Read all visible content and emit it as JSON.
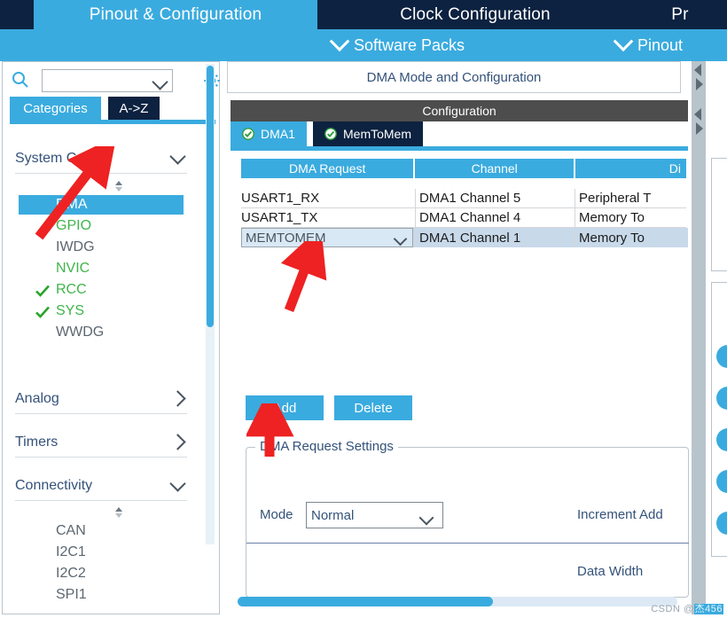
{
  "top_tabs": [
    {
      "label": "Pinout & Configuration",
      "active": true
    },
    {
      "label": "Clock Configuration",
      "active": false
    },
    {
      "label": "Pr",
      "active": false
    }
  ],
  "sub_bar": {
    "software_packs": "Software Packs",
    "pinout": "Pinout",
    "chevron_icon": "chevron-down-icon"
  },
  "sidebar": {
    "search": {
      "value": "",
      "placeholder": "",
      "icon": "search-icon"
    },
    "gear_icon": "gear-icon",
    "tabs": [
      {
        "label": "Categories",
        "active": true
      },
      {
        "label": "A->Z",
        "active": false
      }
    ],
    "groups": [
      {
        "label": "System Core",
        "expanded": true,
        "items": [
          {
            "label": "DMA",
            "state": "selected",
            "check": false
          },
          {
            "label": "GPIO",
            "state": "configured",
            "check": false
          },
          {
            "label": "IWDG",
            "state": "default",
            "check": false
          },
          {
            "label": "NVIC",
            "state": "configured",
            "check": false
          },
          {
            "label": "RCC",
            "state": "configured",
            "check": true
          },
          {
            "label": "SYS",
            "state": "configured",
            "check": true
          },
          {
            "label": "WWDG",
            "state": "default",
            "check": false
          }
        ]
      },
      {
        "label": "Analog",
        "expanded": false,
        "items": []
      },
      {
        "label": "Timers",
        "expanded": false,
        "items": []
      },
      {
        "label": "Connectivity",
        "expanded": true,
        "items": [
          {
            "label": "CAN",
            "state": "default",
            "check": false
          },
          {
            "label": "I2C1",
            "state": "default",
            "check": false
          },
          {
            "label": "I2C2",
            "state": "default",
            "check": false
          },
          {
            "label": "SPI1",
            "state": "default",
            "check": false
          }
        ]
      }
    ]
  },
  "main": {
    "mode_title": "DMA Mode and Configuration",
    "config_title": "Configuration",
    "config_tabs": [
      {
        "label": "DMA1",
        "active": true,
        "icon": "check-circle-icon"
      },
      {
        "label": "MemToMem",
        "active": false,
        "icon": "check-circle-icon"
      }
    ],
    "table": {
      "headers": [
        "DMA Request",
        "Channel",
        "Di"
      ],
      "rows": [
        {
          "request": "USART1_RX",
          "channel": "DMA1 Channel 5",
          "direction": "Peripheral T",
          "selected": false,
          "editing": false
        },
        {
          "request": "USART1_TX",
          "channel": "DMA1 Channel 4",
          "direction": "Memory To",
          "selected": false,
          "editing": false
        },
        {
          "request": "MEMTOMEM",
          "channel": "DMA1 Channel 1",
          "direction": "Memory To",
          "selected": true,
          "editing": true
        }
      ]
    },
    "buttons": {
      "add": "Add",
      "delete": "Delete"
    },
    "settings": {
      "legend": "DMA Request Settings",
      "mode_label": "Mode",
      "mode_value": "Normal",
      "increment_label": "Increment Add",
      "data_width_label": "Data Width"
    }
  },
  "watermark": {
    "prefix": "CSDN @",
    "user": "杰456"
  },
  "colors": {
    "accent": "#3aabdf",
    "dark_nav": "#0d2240",
    "header_gray": "#4d4d4d",
    "row_selected": "#c8d9ea",
    "green_ok": "#29a329",
    "arrow_red": "#ee2222"
  }
}
